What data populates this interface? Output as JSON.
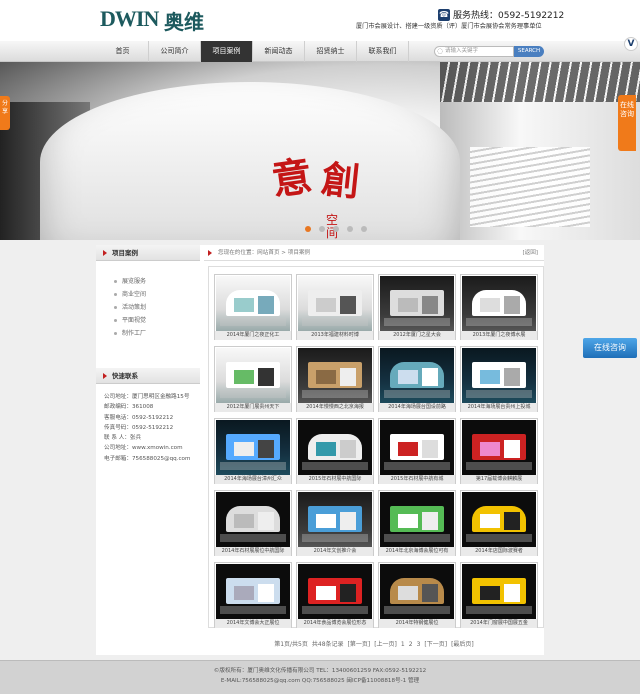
{
  "header": {
    "logo_mark": "DWIN",
    "logo_name": "奥维",
    "hotline": "服务热线：0592-5192212",
    "slogan": "厦门市会展设计、搭建一级资质（评）厦门市会展协会常务理事单位"
  },
  "nav": {
    "items": [
      "首页",
      "公司简介",
      "项目案例",
      "新闻动态",
      "招贤纳士",
      "联系我们"
    ],
    "active": "项目案例",
    "search_placeholder": "请输入关键字",
    "search_label": "SEARCH"
  },
  "banner": {
    "calligraphy_1": "創",
    "calligraphy_2": "意",
    "space_text": "空间",
    "left_tab": "分享",
    "right_tab": "在线咨询",
    "slide_count": 5,
    "active_slide": 1
  },
  "sidebar": {
    "title": "项目案例",
    "links": [
      "展览服务",
      "商业空间",
      "活动策划",
      "平面视觉",
      "制作工厂"
    ],
    "contact_title": "快速联系",
    "contact_lines": [
      "公司地址：厦门思明区金融路15号",
      "邮政编码：361008",
      "客服电话：0592-5192212",
      "传真号码：0592-5192212",
      "联 系 人：张兵",
      "公司地址：www.xmowin.com",
      "电子邮箱：756588025@qq.com"
    ]
  },
  "main": {
    "breadcrumb": "您现在的位置：网站首页 > 项目案例",
    "back": "[返回]",
    "cases": [
      "2014年厦门之夜正化工",
      "2013年福建材料时博",
      "2012年厦门之星大会",
      "2013年厦门之夜博水展",
      "2012年厦门展贵州天下",
      "2014年慢慢西之北京海报",
      "2014年海场展台国设前路",
      "2014年海场展台贵州上投城",
      "2014年海场展台漳州汇众",
      "2015年石材展中航国际",
      "2015年石材展中航有城",
      "第17届载博会麒麟展",
      "2014年石材展展位中航国际",
      "2014年文创推介会",
      "2014年北京海博会展位可有",
      "2014年店国际波赛者",
      "2014年文博会大正展位",
      "2014年食品博览会展位形态",
      "2014年特钢健展位",
      "2014年门窗展中国展五金"
    ],
    "pager": [
      "第1页/共5页",
      "共48条记录",
      "[第一页]",
      "[上一页]",
      "1",
      "2",
      "3",
      "[下一页]",
      "[最后页]"
    ]
  },
  "online_float": "在线咨询",
  "footer": {
    "line1": "©版权所有：厦门奥维文化传播有限公司 TEL：13400601259 FAX:0592-5192212",
    "line2": "E-MAIL:756588025@qq.com QQ:756588025 闽ICP备11008818号-1 管理"
  }
}
